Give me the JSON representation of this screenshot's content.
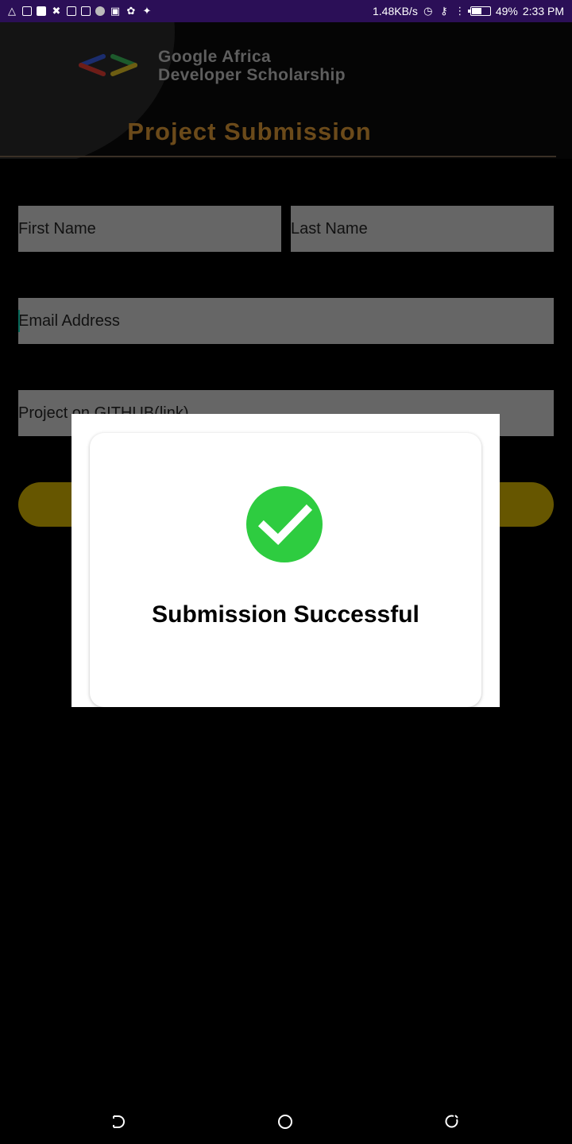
{
  "status_bar": {
    "net_speed": "1.48KB/s",
    "battery": "49%",
    "battery_level": 0.49,
    "time": "2:33 PM"
  },
  "header": {
    "brand_line1": "Google Africa",
    "brand_line2": "Developer Scholarship",
    "title": "Project Submission"
  },
  "form": {
    "first_name_placeholder": "First Name",
    "last_name_placeholder": "Last Name",
    "email_placeholder": "Email Address",
    "github_placeholder": "Project on GITHUB(link)"
  },
  "dialog": {
    "message": "Submission Successful",
    "icon": "check-circle-icon",
    "icon_color": "#2ecc40"
  },
  "colors": {
    "status_bar": "#2b0f57",
    "title_accent": "#c58a2c",
    "submit_button": "#e6c200"
  }
}
